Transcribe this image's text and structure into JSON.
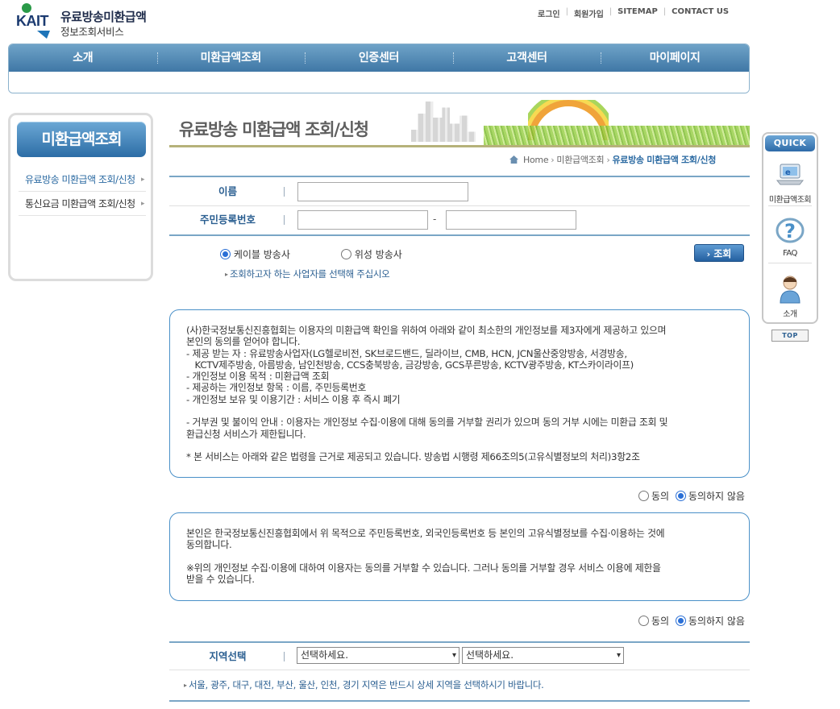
{
  "header": {
    "logo_kait": "KAIT",
    "logo_line1": "유료방송미환급액",
    "logo_line2": "정보조회서비스",
    "links": [
      "로그인",
      "회원가입",
      "SITEMAP",
      "CONTACT US"
    ]
  },
  "gnb": [
    "소개",
    "미환급액조회",
    "인증센터",
    "고객센터",
    "마이페이지"
  ],
  "sidebar": {
    "title": "미환급액조회",
    "items": [
      "유료방송 미환급액 조회/신청",
      "통신요금 미환급액 조회/신청"
    ]
  },
  "banner": {
    "title": "유료방송 미환급액 조회/신청"
  },
  "breadcrumb": {
    "home": "Home",
    "mid": "미환급액조회",
    "current": "유료방송 미환급액 조회/신청"
  },
  "form": {
    "name_label": "이름",
    "rrn_label": "주민등록번호",
    "dash": "-",
    "option_cable": "케이블 방송사",
    "option_satellite": "위성 방송사",
    "hint": "조회하고자 하는 사업자를 선택해 주십시오",
    "search_button": "조회"
  },
  "consent1": {
    "text": "(사)한국정보통신진흥협회는 이용자의 미환급액 확인을 위하여 아래와 같이 최소한의 개인정보를 제3자에게 제공하고 있으며\n본인의 동의를 얻어야 합니다.\n- 제공 받는 자 : 유료방송사업자(LG헬로비전, SK브로드밴드, 딜라이브, CMB, HCN, JCN울산중앙방송, 서경방송,\n   KCTV제주방송, 아름방송, 남인천방송, CCS충북방송, 금강방송, GCS푸른방송, KCTV광주방송, KT스카이라이프)\n- 개인정보 이용 목적 : 미환급액 조회\n- 제공하는 개인정보 항목 : 이름, 주민등록번호\n- 개인정보 보유 및 이용기간 : 서비스 이용 후 즉시 폐기\n\n- 거부권 및 불이익 안내 : 이용자는 개인정보 수집·이용에 대해 동의를 거부할 권리가 있으며 동의 거부 시에는 미환급 조회 및\n환급신청 서비스가 제한됩니다.\n\n* 본 서비스는 아래와 같은 법령을 근거로 제공되고 있습니다. 방송법 시행령 제66조의5(고유식별정보의 처리)3항2조"
  },
  "consent2": {
    "text": "본인은 한국정보통신진흥협회에서 위 목적으로 주민등록번호, 외국인등록번호 등 본인의 고유식별정보를 수집·이용하는 것에\n동의합니다.\n\n※위의 개인정보 수집·이용에 대하여 이용자는 동의를 거부할 수 있습니다. 그러나 동의를 거부할 경우 서비스 이용에 제한을\n받을 수 있습니다."
  },
  "agree": {
    "yes": "동의",
    "no": "동의하지 않음"
  },
  "region": {
    "label": "지역선택",
    "select1": "선택하세요.",
    "select2": "선택하세요.",
    "hint": "서울, 광주, 대구, 대전, 부산, 울산, 인천, 경기 지역은 반드시 상세 지역을 선택하시기 바랍니다."
  },
  "quick": {
    "title": "QUICK",
    "items": [
      "미환급액조회",
      "FAQ",
      "소개"
    ],
    "top": "TOP"
  }
}
